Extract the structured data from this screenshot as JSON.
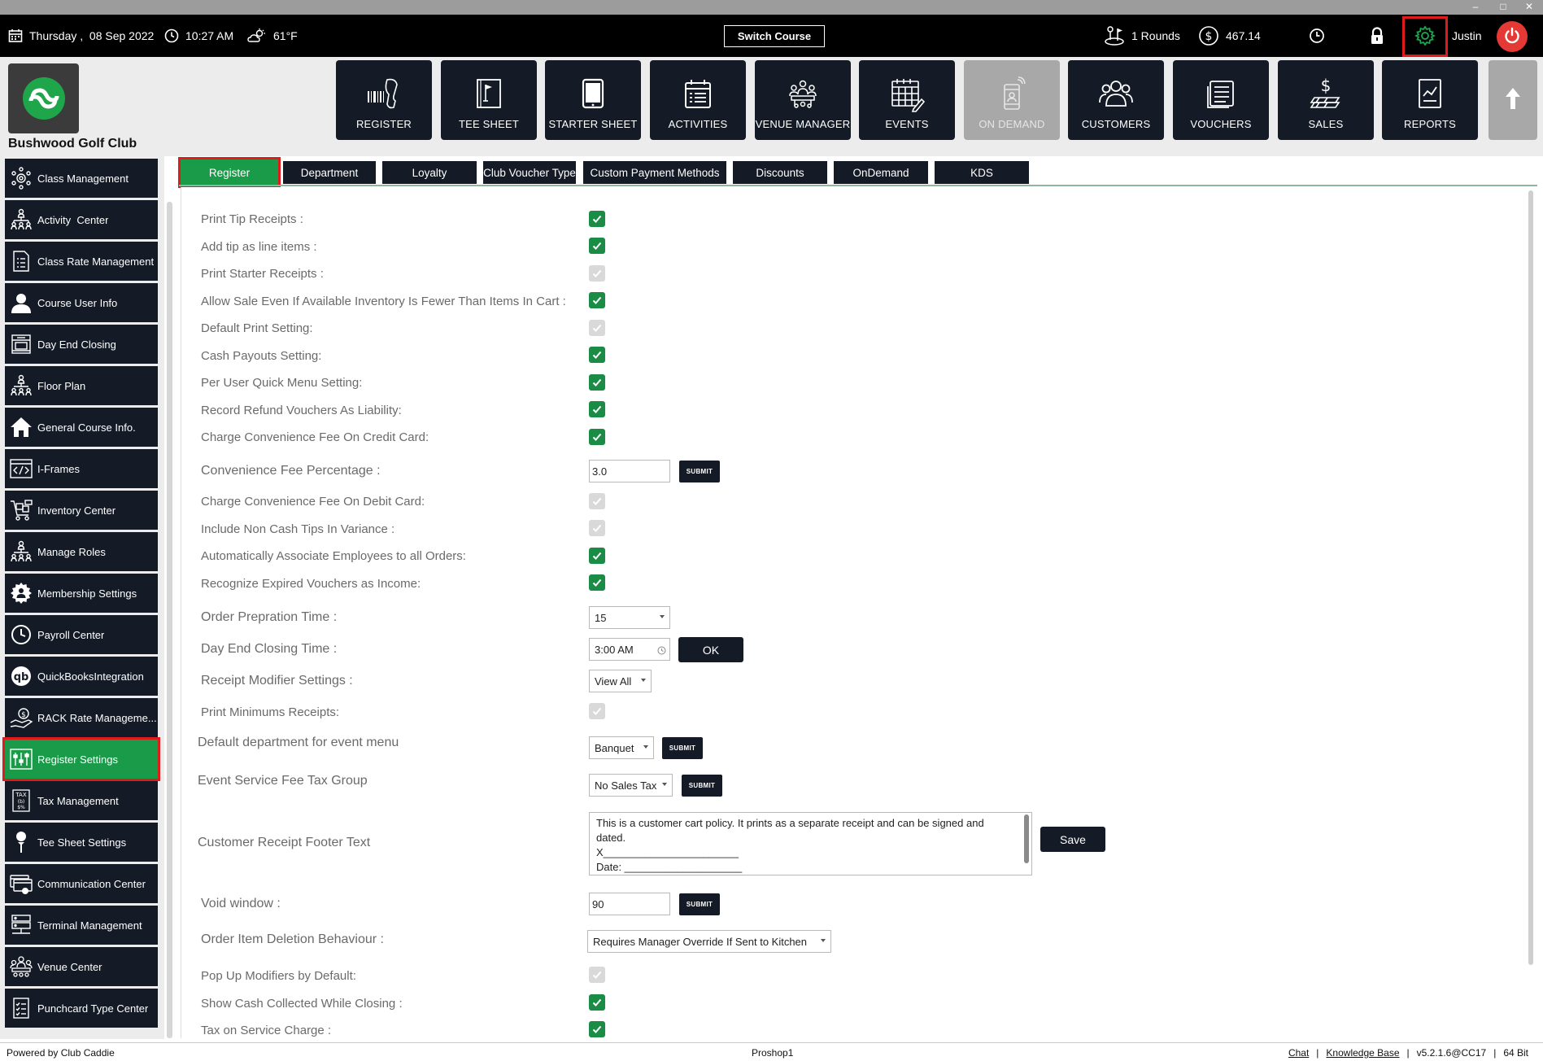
{
  "window": {
    "minimize": "–",
    "maximize": "□",
    "close": "✕"
  },
  "topbar": {
    "date": "Thursday ,  08 Sep 2022",
    "time": "10:27 AM",
    "weather": "61°F",
    "switch_course": "Switch Course",
    "rounds": "1 Rounds",
    "balance": "467.14",
    "user": "Justin"
  },
  "header": {
    "club_name": "Bushwood Golf Club",
    "nav": [
      {
        "label": "REGISTER",
        "icon": "barcode-scanner-icon"
      },
      {
        "label": "TEE SHEET",
        "icon": "tee-sheet-icon"
      },
      {
        "label": "STARTER SHEET",
        "icon": "tablet-icon"
      },
      {
        "label": "ACTIVITIES",
        "icon": "calendar-list-icon"
      },
      {
        "label": "VENUE MANAGER",
        "icon": "venue-meeting-icon"
      },
      {
        "label": "EVENTS",
        "icon": "events-calendar-icon"
      },
      {
        "label": "ON DEMAND",
        "icon": "mobile-order-icon"
      },
      {
        "label": "CUSTOMERS",
        "icon": "customers-icon"
      },
      {
        "label": "VOUCHERS",
        "icon": "vouchers-icon"
      },
      {
        "label": "SALES",
        "icon": "sales-money-icon"
      },
      {
        "label": "REPORTS",
        "icon": "reports-chart-icon"
      }
    ]
  },
  "sidebar": {
    "items": [
      {
        "label": "Class Management"
      },
      {
        "label": "Activity  Center"
      },
      {
        "label": "Class Rate Management"
      },
      {
        "label": "Course User Info"
      },
      {
        "label": "Day End Closing"
      },
      {
        "label": "Floor Plan"
      },
      {
        "label": "General Course Info."
      },
      {
        "label": "I-Frames"
      },
      {
        "label": "Inventory Center"
      },
      {
        "label": "Manage Roles"
      },
      {
        "label": "Membership Settings"
      },
      {
        "label": "Payroll Center"
      },
      {
        "label": "QuickBooksIntegration"
      },
      {
        "label": "RACK Rate Manageme..."
      },
      {
        "label": "Register Settings"
      },
      {
        "label": "Tax Management"
      },
      {
        "label": "Tee Sheet Settings"
      },
      {
        "label": "Communication Center"
      },
      {
        "label": "Terminal Management"
      },
      {
        "label": "Venue Center"
      },
      {
        "label": "Punchcard Type Center"
      }
    ]
  },
  "tabs": [
    {
      "label": "Register"
    },
    {
      "label": "Department"
    },
    {
      "label": "Loyalty"
    },
    {
      "label": "Club Voucher Type"
    },
    {
      "label": "Custom Payment Methods"
    },
    {
      "label": "Discounts"
    },
    {
      "label": "OnDemand"
    },
    {
      "label": "KDS"
    }
  ],
  "settings": {
    "print_tip_receipts": {
      "label": "Print Tip Receipts :",
      "checked": true
    },
    "add_tip_line_items": {
      "label": "Add tip as line items :",
      "checked": true
    },
    "print_starter_receipts": {
      "label": "Print Starter Receipts :",
      "checked": false
    },
    "allow_sale_inventory": {
      "label": "Allow Sale Even If Available Inventory Is Fewer Than Items In Cart :",
      "checked": true
    },
    "default_print_setting": {
      "label": "Default Print Setting:",
      "checked": false
    },
    "cash_payouts_setting": {
      "label": "Cash Payouts Setting:",
      "checked": true
    },
    "per_user_quick_menu": {
      "label": "Per User Quick Menu Setting:",
      "checked": true
    },
    "record_refund_vouchers": {
      "label": "Record Refund Vouchers As Liability:",
      "checked": true
    },
    "charge_fee_credit": {
      "label": "Charge Convenience Fee On Credit Card:",
      "checked": true
    },
    "convenience_fee_pct": {
      "label": "Convenience Fee Percentage :",
      "value": "3.0",
      "submit": "SUBMIT"
    },
    "charge_fee_debit": {
      "label": "Charge Convenience Fee On Debit Card:",
      "checked": false
    },
    "include_non_cash_tips": {
      "label": "Include Non Cash Tips In Variance :",
      "checked": false
    },
    "auto_associate_employees": {
      "label": "Automatically Associate Employees to all Orders:",
      "checked": true
    },
    "recognize_expired_vouchers": {
      "label": "Recognize Expired Vouchers as Income:",
      "checked": true
    },
    "order_prep_time": {
      "label": "Order Prepration Time :",
      "value": "15"
    },
    "day_end_closing_time": {
      "label": "Day End Closing Time :",
      "value": "3:00 AM",
      "ok": "OK"
    },
    "receipt_modifier": {
      "label": "Receipt Modifier Settings :",
      "value": "View All"
    },
    "print_minimums_receipts": {
      "label": "Print Minimums Receipts:",
      "checked": false
    },
    "default_department_event": {
      "label": "Default department for event menu",
      "value": "Banquet",
      "submit": "SUBMIT"
    },
    "event_service_fee_tax": {
      "label": "Event Service Fee Tax Group",
      "value": "No Sales Tax",
      "submit": "SUBMIT"
    },
    "receipt_footer": {
      "label": "Customer Receipt Footer Text",
      "lines": [
        "This is a customer cart policy. It prints as a separate receipt and can be signed and",
        "dated.",
        "X_______________________",
        "Date: ____________________"
      ],
      "save": "Save"
    },
    "void_window": {
      "label": "Void window :",
      "value": "90",
      "submit": "SUBMIT"
    },
    "order_item_deletion": {
      "label": "Order Item Deletion Behaviour :",
      "value": "Requires Manager Override If Sent to Kitchen"
    },
    "popup_modifiers": {
      "label": "Pop Up Modifiers by Default:",
      "checked": false
    },
    "show_cash_collected": {
      "label": "Show Cash Collected While Closing :",
      "checked": true
    },
    "tax_on_service_charge": {
      "label": "Tax on Service Charge :",
      "checked": true
    }
  },
  "footer": {
    "powered_by": "Powered by Club Caddie",
    "station": "Proshop1",
    "chat": "Chat",
    "sep1": "|",
    "knowledge_base": "Knowledge Base",
    "sep2": "|",
    "version": "v5.2.1.6@CC17",
    "sep3": "|",
    "bits": "64 Bit"
  },
  "colors": {
    "primary_dark": "#141a26",
    "accent_green": "#1a9b4a",
    "highlight_red": "#e01b1b",
    "power_red": "#e53935"
  }
}
